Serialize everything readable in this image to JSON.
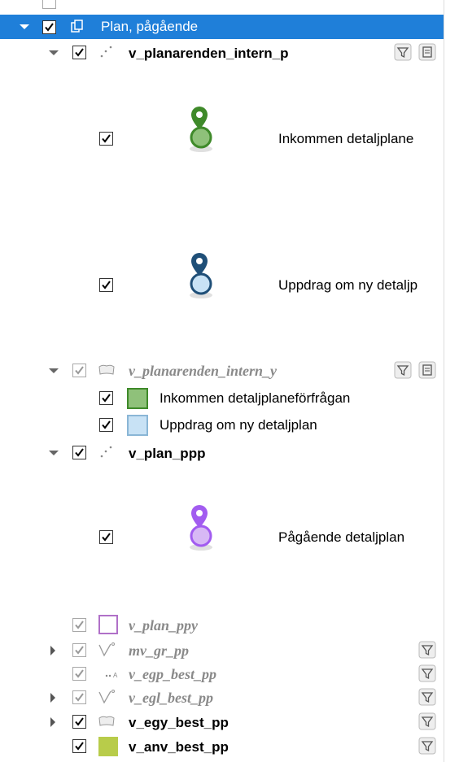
{
  "layer_tree": {
    "group": {
      "label": "Plan, pågående"
    },
    "layers": [
      {
        "name": "v_planarenden_intern_p",
        "legend": [
          {
            "label": "Inkommen detaljplane",
            "color": "#3f8a2a"
          },
          {
            "label": "Uppdrag om ny detaljp",
            "color": "#1f4f78"
          }
        ]
      },
      {
        "name": "v_planarenden_intern_y",
        "legend": [
          {
            "label": "Inkommen detaljplaneförfrågan",
            "color": "#8fc17a"
          },
          {
            "label": "Uppdrag om ny detaljplan",
            "color": "#c8e2f5"
          }
        ]
      },
      {
        "name": "v_plan_ppp",
        "legend": [
          {
            "label": "Pågående detaljplan",
            "color": "#a25cf0"
          }
        ]
      },
      {
        "name": "v_plan_ppy"
      },
      {
        "name": "mv_gr_pp"
      },
      {
        "name": "v_egp_best_pp"
      },
      {
        "name": "v_egl_best_pp"
      },
      {
        "name": "v_egy_best_pp"
      },
      {
        "name": "v_anv_best_pp"
      }
    ]
  },
  "colors": {
    "selection": "#1f7fd9",
    "anv_fill": "#b8cc4a",
    "ppy_border": "#b070c8"
  }
}
